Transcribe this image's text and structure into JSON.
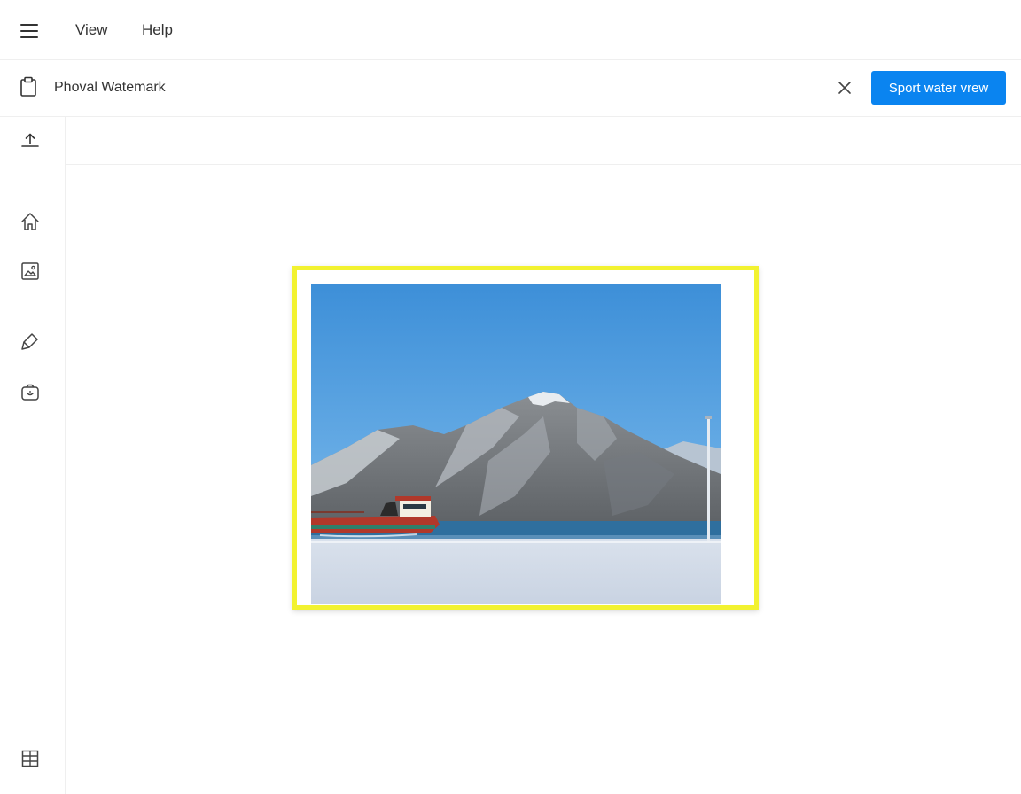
{
  "menubar": {
    "items": [
      {
        "label": "View"
      },
      {
        "label": "Help"
      }
    ]
  },
  "document": {
    "title": "Phoval Watemark",
    "primary_button_label": "Sport water vrew"
  },
  "icons": {
    "menu": "hamburger-menu-icon",
    "document": "clipboard-icon",
    "close": "close-icon",
    "upload": "upload-icon",
    "home": "home-icon",
    "image": "image-icon",
    "brush": "brush-icon",
    "camera": "camera-icon",
    "layout": "grid-icon"
  },
  "colors": {
    "accent": "#0a84f0",
    "frame_highlight": "#f2f230"
  }
}
